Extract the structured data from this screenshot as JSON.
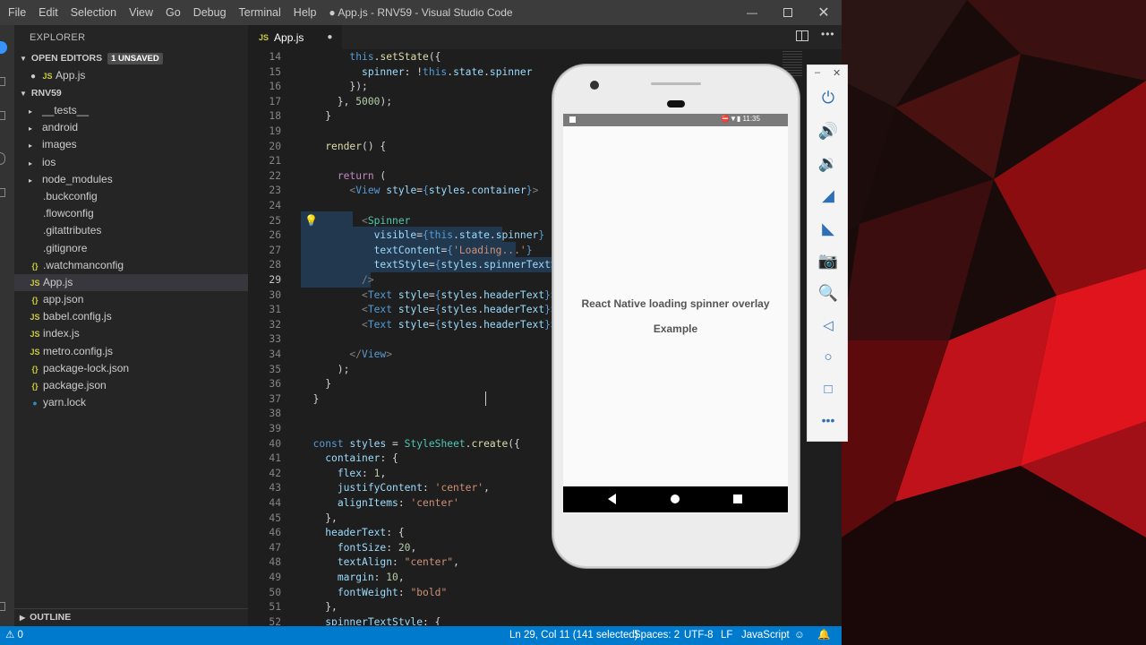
{
  "window": {
    "title": "● App.js - RNV59 - Visual Studio Code",
    "menu": [
      "File",
      "Edit",
      "Selection",
      "View",
      "Go",
      "Debug",
      "Terminal",
      "Help"
    ]
  },
  "sidebar": {
    "title": "EXPLORER",
    "open_editors": {
      "label": "OPEN EDITORS",
      "badge": "1 UNSAVED",
      "file": "App.js"
    },
    "project": "RNV59",
    "items": [
      {
        "label": "__tests__",
        "type": "folder"
      },
      {
        "label": "android",
        "type": "folder"
      },
      {
        "label": "images",
        "type": "folder"
      },
      {
        "label": "ios",
        "type": "folder"
      },
      {
        "label": "node_modules",
        "type": "folder"
      },
      {
        "label": ".buckconfig",
        "type": "file"
      },
      {
        "label": ".flowconfig",
        "type": "file"
      },
      {
        "label": ".gitattributes",
        "type": "file"
      },
      {
        "label": ".gitignore",
        "type": "file"
      },
      {
        "label": ".watchmanconfig",
        "type": "json"
      },
      {
        "label": "App.js",
        "type": "js"
      },
      {
        "label": "app.json",
        "type": "json"
      },
      {
        "label": "babel.config.js",
        "type": "js"
      },
      {
        "label": "index.js",
        "type": "js"
      },
      {
        "label": "metro.config.js",
        "type": "js"
      },
      {
        "label": "package-lock.json",
        "type": "json"
      },
      {
        "label": "package.json",
        "type": "json"
      },
      {
        "label": "yarn.lock",
        "type": "yarn"
      }
    ],
    "outline": "OUTLINE"
  },
  "tab": {
    "label": "App.js",
    "icon": "JS"
  },
  "editor": {
    "lines": [
      {
        "n": "14",
        "html": "        <span class='kw'>this</span>.<span class='fn'>setState</span>({"
      },
      {
        "n": "15",
        "html": "          <span class='pr'>spinner</span>: !<span class='kw'>this</span>.<span class='pr'>state</span>.<span class='pr'>spinner</span>"
      },
      {
        "n": "16",
        "html": "        });"
      },
      {
        "n": "17",
        "html": "      }, <span class='nm'>5000</span>);"
      },
      {
        "n": "18",
        "html": "    }"
      },
      {
        "n": "19",
        "html": ""
      },
      {
        "n": "20",
        "html": "    <span class='fn'>render</span>() {"
      },
      {
        "n": "21",
        "html": ""
      },
      {
        "n": "22",
        "html": "      <span class='ctl'>return</span> ("
      },
      {
        "n": "23",
        "html": "        <span class='gr'>&lt;</span><span class='tg'>View</span> <span class='pr'>style</span>=<span class='kw'>{</span><span class='pr'>styles</span>.<span class='pr'>container</span><span class='kw'>}</span><span class='gr'>&gt;</span>"
      },
      {
        "n": "24",
        "html": ""
      },
      {
        "n": "25",
        "html": "          <span class='gr'>&lt;</span><span class='cl'>Spinner</span>"
      },
      {
        "n": "26",
        "html": "            <span class='pr'>visible</span>=<span class='kw'>{this</span>.<span class='pr'>state</span>.<span class='pr'>spinner</span><span class='kw'>}</span>"
      },
      {
        "n": "27",
        "html": "            <span class='pr'>textContent</span>=<span class='kw'>{</span><span class='st'>'Loading...'</span><span class='kw'>}</span>"
      },
      {
        "n": "28",
        "html": "            <span class='pr'>textStyle</span>=<span class='kw'>{</span><span class='pr'>styles</span>.<span class='pr'>spinnerTextSty</span>"
      },
      {
        "n": "29",
        "html": "          <span class='gr'>/&gt;</span>"
      },
      {
        "n": "30",
        "html": "          <span class='gr'>&lt;</span><span class='tg'>Text</span> <span class='pr'>style</span>=<span class='kw'>{</span><span class='pr'>styles</span>.<span class='pr'>headerText</span><span class='kw'>}</span><span class='gr'>&gt;</span>We"
      },
      {
        "n": "31",
        "html": "          <span class='gr'>&lt;</span><span class='tg'>Text</span> <span class='pr'>style</span>=<span class='kw'>{</span><span class='pr'>styles</span>.<span class='pr'>headerText</span><span class='kw'>}</span><span class='gr'>&gt;</span>Re"
      },
      {
        "n": "32",
        "html": "          <span class='gr'>&lt;</span><span class='tg'>Text</span> <span class='pr'>style</span>=<span class='kw'>{</span><span class='pr'>styles</span>.<span class='pr'>headerText</span><span class='kw'>}</span><span class='gr'>&gt;</span>Ex"
      },
      {
        "n": "33",
        "html": ""
      },
      {
        "n": "34",
        "html": "        <span class='gr'>&lt;/</span><span class='tg'>View</span><span class='gr'>&gt;</span>"
      },
      {
        "n": "35",
        "html": "      );"
      },
      {
        "n": "36",
        "html": "    }"
      },
      {
        "n": "37",
        "html": "  }"
      },
      {
        "n": "38",
        "html": ""
      },
      {
        "n": "39",
        "html": ""
      },
      {
        "n": "40",
        "html": "  <span class='kw'>const</span> <span class='pr'>styles</span> = <span class='cl'>StyleSheet</span>.<span class='fn'>create</span>({"
      },
      {
        "n": "41",
        "html": "    <span class='pr'>container</span>: {"
      },
      {
        "n": "42",
        "html": "      <span class='pr'>flex</span>: <span class='nm'>1</span>,"
      },
      {
        "n": "43",
        "html": "      <span class='pr'>justifyContent</span>: <span class='st'>'center'</span>,"
      },
      {
        "n": "44",
        "html": "      <span class='pr'>alignItems</span>: <span class='st'>'center'</span>"
      },
      {
        "n": "45",
        "html": "    },"
      },
      {
        "n": "46",
        "html": "    <span class='pr'>headerText</span>: {"
      },
      {
        "n": "47",
        "html": "      <span class='pr'>fontSize</span>: <span class='nm'>20</span>,"
      },
      {
        "n": "48",
        "html": "      <span class='pr'>textAlign</span>: <span class='st'>\"center\"</span>,"
      },
      {
        "n": "49",
        "html": "      <span class='pr'>margin</span>: <span class='nm'>10</span>,"
      },
      {
        "n": "50",
        "html": "      <span class='pr'>fontWeight</span>: <span class='st'>\"bold\"</span>"
      },
      {
        "n": "51",
        "html": "    },"
      },
      {
        "n": "52",
        "html": "    <span class='pr'>spinnerTextStyle</span>: {"
      }
    ]
  },
  "statusbar": {
    "errors": "0",
    "cursor": "Ln 29, Col 11 (141 selected)",
    "spaces": "Spaces: 2",
    "encoding": "UTF-8",
    "eol": "LF",
    "language": "JavaScript"
  },
  "emulator": {
    "time": "11:35",
    "app_text": [
      "React Native loading spinner overlay",
      "Example"
    ]
  }
}
